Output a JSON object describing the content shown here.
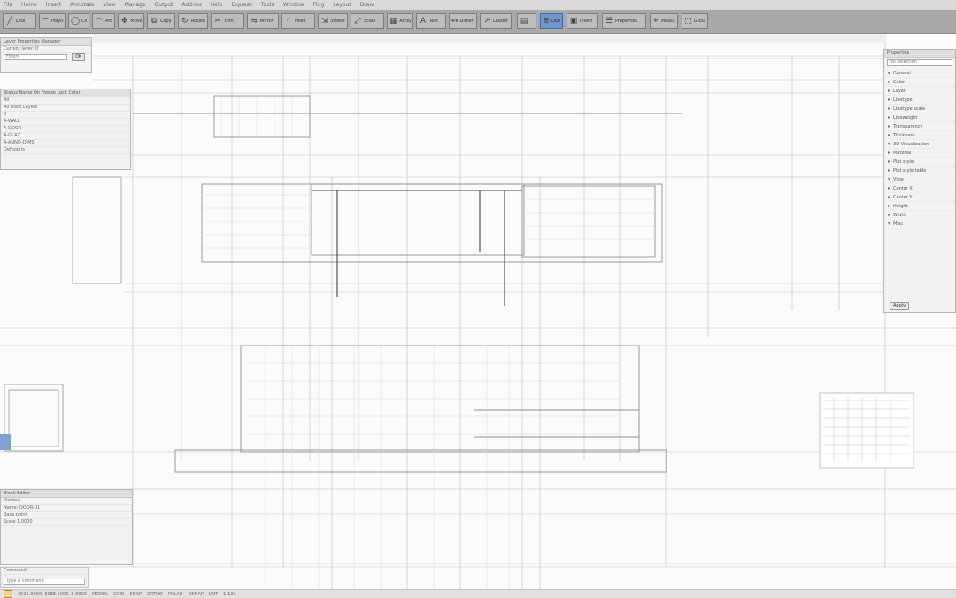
{
  "menu": {
    "items": [
      "File",
      "Home",
      "Insert",
      "Annotate",
      "View",
      "Manage",
      "Output",
      "Add-ins",
      "Help",
      "Express",
      "Tools",
      "Window",
      "Plug",
      "Layout",
      "Draw"
    ]
  },
  "ribbon": {
    "buttons": [
      {
        "icon": "line-icon",
        "glyph": "╱",
        "label": "Line"
      },
      {
        "icon": "polyline-icon",
        "glyph": "⌒",
        "label": "Polyline"
      },
      {
        "icon": "circle-icon",
        "glyph": "◯",
        "label": "Circle"
      },
      {
        "icon": "arc-icon",
        "glyph": "◠",
        "label": "Arc"
      },
      {
        "icon": "move-icon",
        "glyph": "✥",
        "label": "Move"
      },
      {
        "icon": "copy-icon",
        "glyph": "⧉",
        "label": "Copy"
      },
      {
        "icon": "rotate-icon",
        "glyph": "↻",
        "label": "Rotate"
      },
      {
        "icon": "trim-icon",
        "glyph": "✂",
        "label": "Trim"
      },
      {
        "icon": "mirror-icon",
        "glyph": "⇋",
        "label": "Mirror"
      },
      {
        "icon": "fillet-icon",
        "glyph": "◜",
        "label": "Fillet"
      },
      {
        "icon": "stretch-icon",
        "glyph": "⇲",
        "label": "Stretch"
      },
      {
        "icon": "scale-icon",
        "glyph": "⤢",
        "label": "Scale"
      },
      {
        "icon": "array-icon",
        "glyph": "▦",
        "label": "Array"
      },
      {
        "icon": "text-icon",
        "glyph": "A",
        "label": "Text"
      },
      {
        "icon": "dimension-icon",
        "glyph": "↔",
        "label": "Dimension"
      },
      {
        "icon": "leader-icon",
        "glyph": "↗",
        "label": "Leader"
      },
      {
        "icon": "table-icon",
        "glyph": "▤",
        "label": "Table"
      },
      {
        "icon": "layer-icon",
        "glyph": "≣",
        "label": "Layers"
      },
      {
        "icon": "block-icon",
        "glyph": "▣",
        "label": "Insert"
      },
      {
        "icon": "properties-icon",
        "glyph": "☰",
        "label": "Properties"
      },
      {
        "icon": "measure-icon",
        "glyph": "⌖",
        "label": "Measure"
      },
      {
        "icon": "group-icon",
        "glyph": "⬚",
        "label": "Group"
      }
    ]
  },
  "left_panel": {
    "title": "Layer Properties Manager",
    "rows": [
      "Current layer: 0",
      "Filters",
      "All",
      "All Used Layers",
      "Status  Name  On  Freeze  Lock  Color",
      "0",
      "A-WALL",
      "A-DOOR",
      "A-GLAZ",
      "A-ANNO-DIMS",
      "Defpoints"
    ],
    "button_label": "OK"
  },
  "right_panel": {
    "title": "Properties",
    "dropdown": "No selection",
    "tree_rows": [
      "General",
      "Color",
      "Layer",
      "Linetype",
      "Linetype scale",
      "Lineweight",
      "Transparency",
      "Thickness",
      "3D Visualization",
      "Material",
      "Plot style",
      "Plot style table",
      "View",
      "Center X",
      "Center Y",
      "Height",
      "Width",
      "Misc"
    ],
    "footer_button": "Apply"
  },
  "bottom_left_panel": {
    "title": "Block Editor",
    "rows": [
      "Preview",
      "Name: DOOR-01",
      "Base point",
      "Scale 1.0000"
    ]
  },
  "command": {
    "placeholder": "Type a command",
    "history": "Command:"
  },
  "status": {
    "coords": "4521.0000, 3188.5000, 0.0000",
    "items": [
      "MODEL",
      "GRID",
      "SNAP",
      "ORTHO",
      "POLAR",
      "OSNAP",
      "LWT",
      "1:100"
    ]
  }
}
